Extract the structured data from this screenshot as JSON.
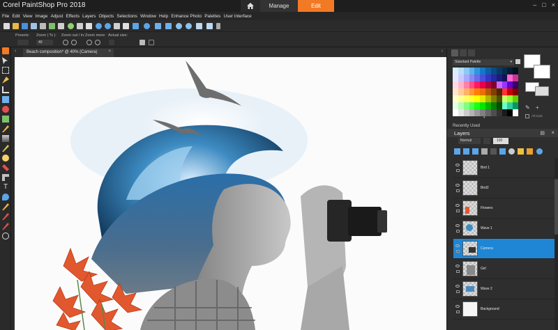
{
  "app": {
    "title": "Corel PaintShop Pro 2018",
    "workspace_tabs": [
      {
        "label": "Manage",
        "active": false
      },
      {
        "label": "Edit",
        "active": true
      }
    ],
    "accent_color": "#f27a24",
    "selection_color": "#1f86d6"
  },
  "menu": [
    "File",
    "Edit",
    "View",
    "Image",
    "Adjust",
    "Effects",
    "Layers",
    "Objects",
    "Selections",
    "Window",
    "Help",
    "Enhance Photo",
    "Palettes",
    "User Interface"
  ],
  "options_bar": {
    "presets_label": "Presets:",
    "zoom_pct_label": "Zoom ( % ):",
    "zoom_value": "40",
    "zoom_in_out_label": "Zoom out / in:",
    "zoom_more_label": "Zoom more:",
    "actual_size_label": "Actual size:"
  },
  "document": {
    "tab_label": "Beach composition* @  40% (Camera)"
  },
  "materials": {
    "palette_select": "Standard Palette",
    "all_tools_label": "All tools"
  },
  "recently_used_label": "Recently Used",
  "layers_panel": {
    "title": "Layers",
    "blend_mode": "Normal",
    "opacity": "100",
    "layers": [
      {
        "name": "Bird 1",
        "selected": false
      },
      {
        "name": "Bird2",
        "selected": false
      },
      {
        "name": "Flowers",
        "selected": false
      },
      {
        "name": "Wave 1",
        "selected": false
      },
      {
        "name": "Camera",
        "selected": true
      },
      {
        "name": "Girl",
        "selected": false
      },
      {
        "name": "Wave 2",
        "selected": false
      },
      {
        "name": "Background",
        "selected": false
      }
    ]
  }
}
